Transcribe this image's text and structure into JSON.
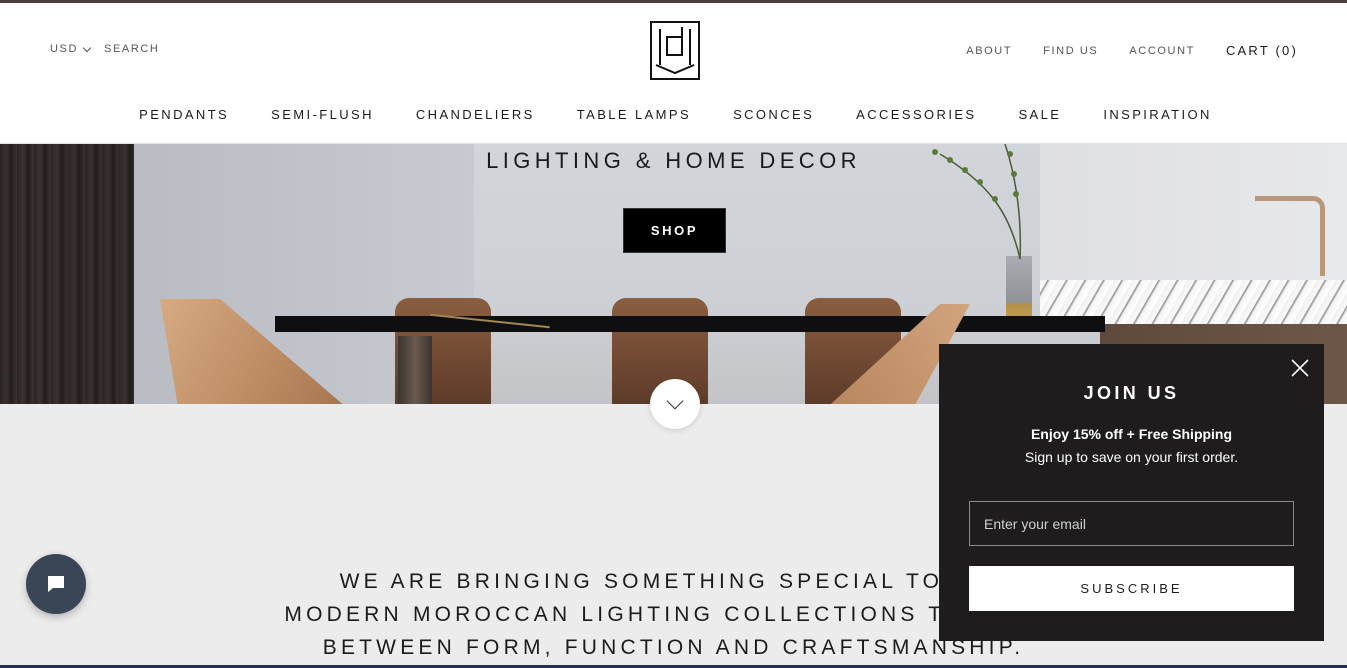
{
  "header": {
    "currency": "USD",
    "search_label": "SEARCH",
    "links": [
      "ABOUT",
      "FIND US",
      "ACCOUNT"
    ],
    "cart_label": "CART (0)"
  },
  "nav": {
    "items": [
      "PENDANTS",
      "SEMI-FLUSH",
      "CHANDELIERS",
      "TABLE LAMPS",
      "SCONCES",
      "ACCESSORIES",
      "SALE",
      "INSPIRATION"
    ]
  },
  "hero": {
    "title": "LIGHTING & HOME DECOR",
    "button_label": "SHOP"
  },
  "mission": {
    "lines": [
      "WE ARE BRINGING SOMETHING SPECIAL TO THE",
      "MODERN MOROCCAN LIGHTING COLLECTIONS THAT ARE",
      "BETWEEN FORM, FUNCTION AND CRAFTSMANSHIP."
    ]
  },
  "popup": {
    "title": "JOIN US",
    "offer": "Enjoy 15% off + Free Shipping",
    "subtitle": "Sign up to save on your first order.",
    "email_placeholder": "Enter your email",
    "subscribe_label": "SUBSCRIBE"
  },
  "colors": {
    "popup_bg": "#1e1c1c",
    "chat_bubble": "#3a4656",
    "page_bg": "#ececec",
    "shop_button": "#000000"
  },
  "icons": {
    "logo": "brand-logo",
    "chevron": "chevron-down-icon",
    "close": "close-icon",
    "chat": "chat-icon"
  }
}
